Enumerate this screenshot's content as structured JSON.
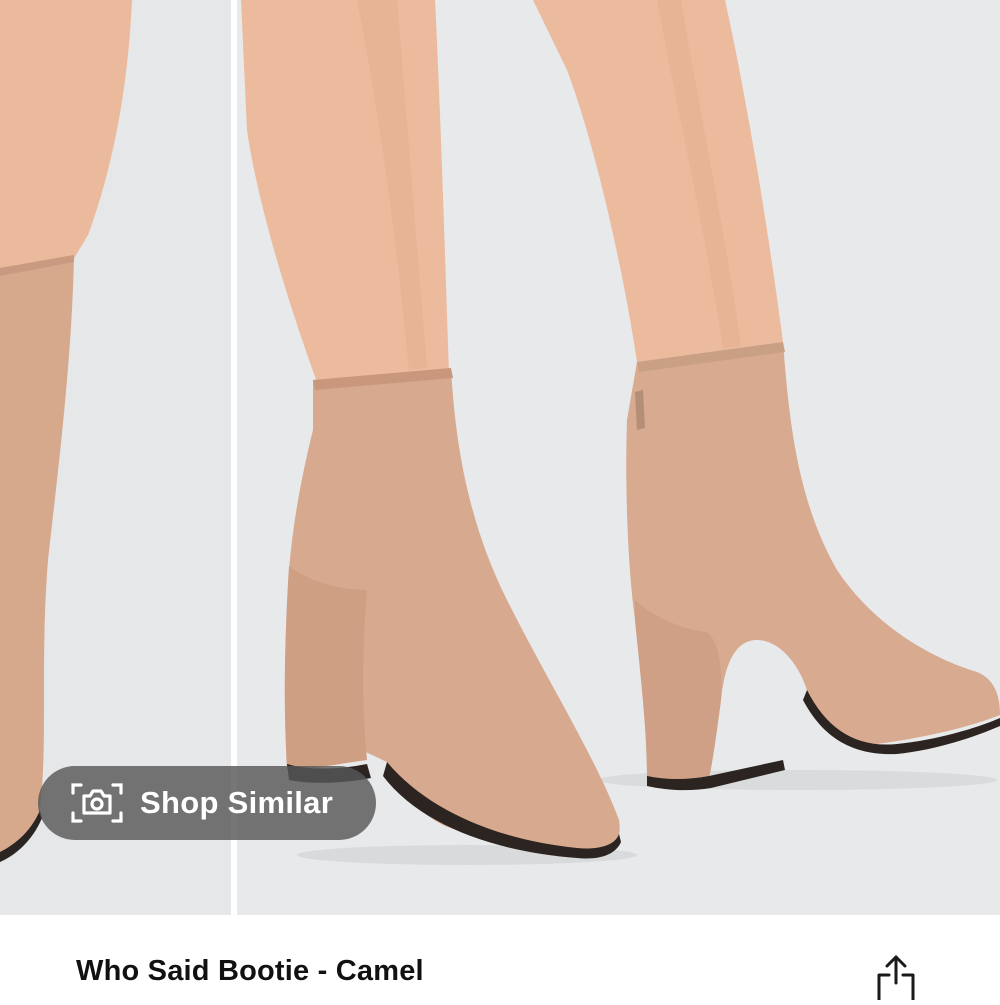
{
  "product": {
    "title": "Who Said Bootie - Camel",
    "color": "Camel"
  },
  "gallery": {
    "shop_similar_label": "Shop Similar",
    "shop_similar_icon": "camera-icon",
    "images": [
      "product-photo-left-partial",
      "product-photo-main"
    ]
  },
  "actions": {
    "share_icon": "share-icon"
  },
  "colors": {
    "photo_background": "#e8e9eb",
    "suede": "#d7a98e",
    "skin": "#ebb99c",
    "overlay": "#585858"
  }
}
